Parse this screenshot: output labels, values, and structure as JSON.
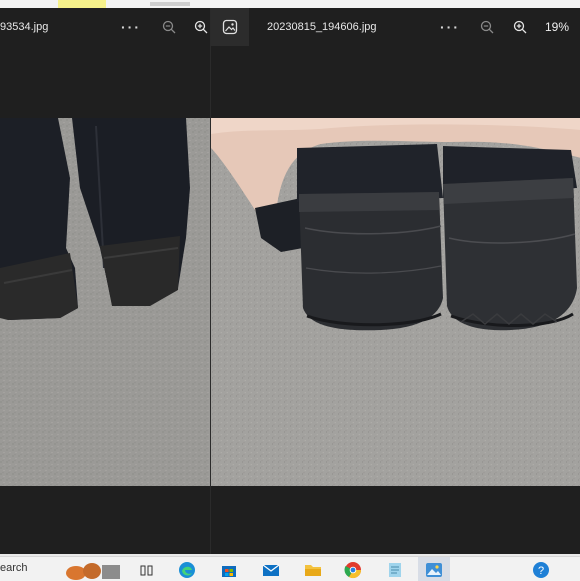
{
  "left_viewer": {
    "filename": "93534.jpg",
    "more_icon": "ellipsis-icon",
    "zoom_out_icon": "zoom-out-icon",
    "zoom_in_icon": "zoom-in-icon"
  },
  "right_viewer": {
    "filename": "20230815_194606.jpg",
    "zoom_level": "19%",
    "app_icon": "photos-app-icon",
    "more_icon": "ellipsis-icon",
    "zoom_out_icon": "zoom-out-icon",
    "zoom_in_icon": "zoom-in-icon"
  },
  "taskbar": {
    "search_text": "earch",
    "icons": [
      "task-view-icon",
      "edge-icon",
      "store-icon",
      "mail-icon",
      "file-explorer-icon",
      "chrome-icon",
      "notepad-icon",
      "photos-icon",
      "help-icon"
    ]
  },
  "colors": {
    "viewer_bg": "#1f1f1f",
    "taskbar_bg": "#f2f2f2"
  }
}
